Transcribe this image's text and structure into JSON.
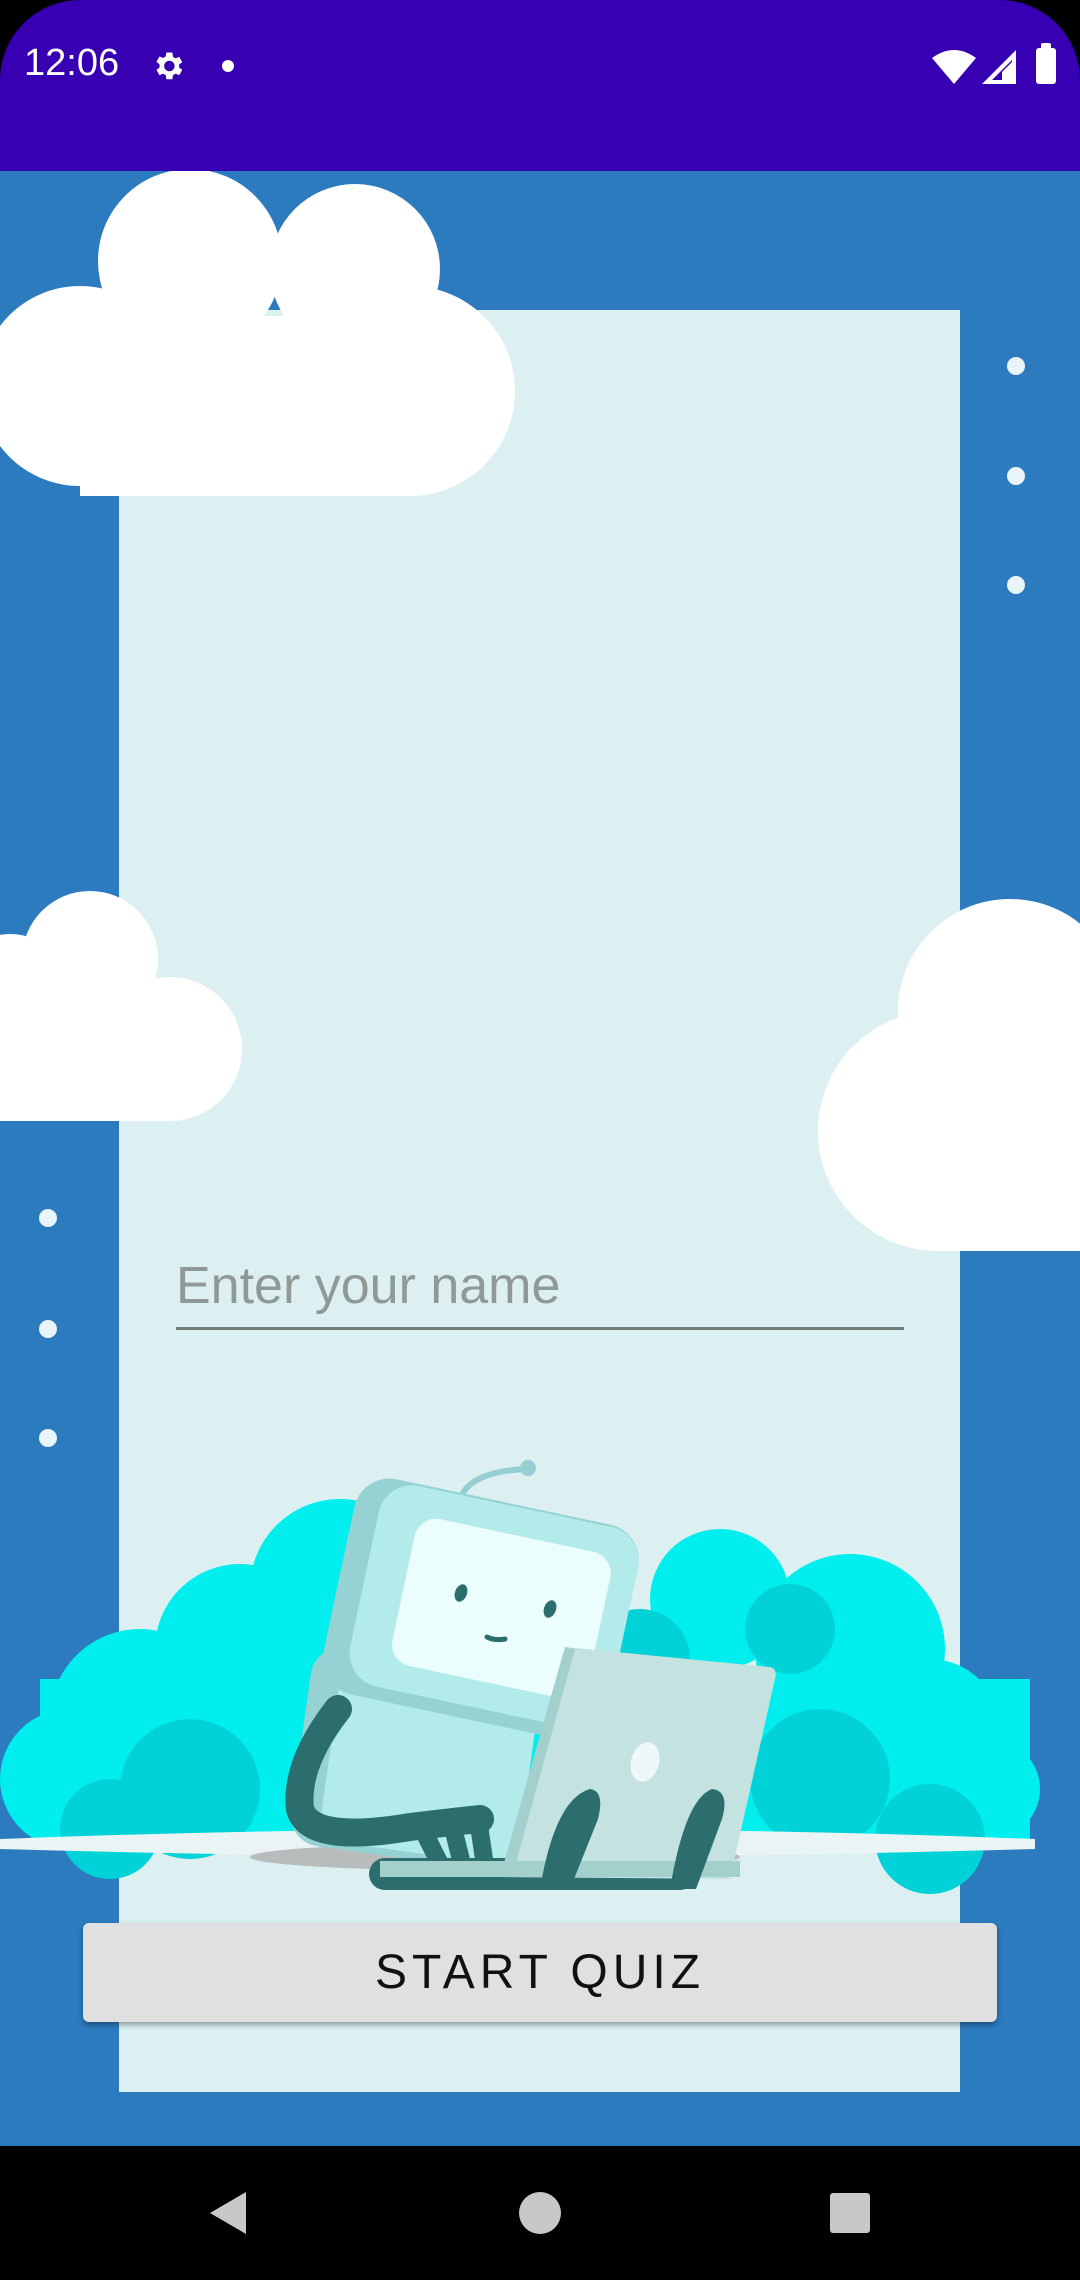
{
  "status_bar": {
    "time": "12:06",
    "icons": [
      "gear-icon",
      "notification-dot-icon",
      "wifi-icon",
      "signal-icon",
      "battery-icon"
    ],
    "background": "#3700b3"
  },
  "screen": {
    "background": "#2c7bbf",
    "panel_color": "#dcf0f1"
  },
  "name_field": {
    "placeholder": "Enter your name",
    "value": ""
  },
  "start_button": {
    "label": "START QUIZ"
  },
  "illustration": {
    "subject": "robot-with-laptop-illustration"
  },
  "nav_bar": {
    "buttons": [
      "back-icon",
      "home-icon",
      "recents-icon"
    ]
  }
}
